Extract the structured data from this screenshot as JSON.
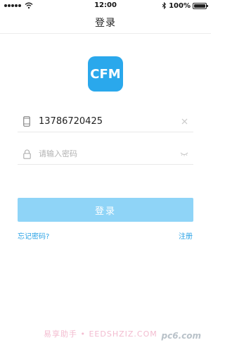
{
  "status_bar": {
    "time": "12:00",
    "battery": "100%",
    "bluetooth_icon": "bluetooth-icon",
    "wifi_icon": "wifi-icon"
  },
  "nav": {
    "title": "登录"
  },
  "logo": {
    "text": "CFM",
    "color": "#2aa8ec"
  },
  "form": {
    "phone_value": "13786720425",
    "phone_icon": "phone-icon",
    "clear_icon": "clear-icon",
    "password_placeholder": "请输入密码",
    "lock_icon": "lock-icon",
    "eye_icon": "eye-closed-icon"
  },
  "actions": {
    "login_label": "登录",
    "forgot_label": "忘记密码?",
    "register_label": "注册",
    "accent_color": "#2ba3e6",
    "button_color": "#8fd4f7"
  },
  "watermark": {
    "text": "易享助手 • EEDSHZIZ.COM",
    "pc6": "pc6.com"
  }
}
